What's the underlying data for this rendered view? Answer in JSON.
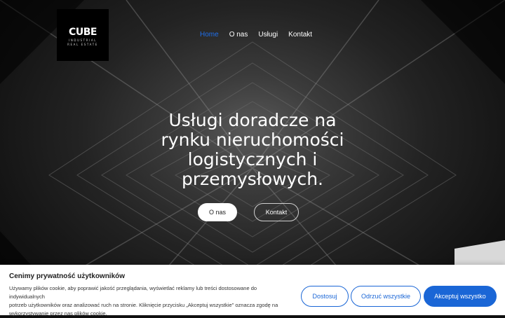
{
  "logo": {
    "mark": "CUBE",
    "line1": "INDUSTRIAL",
    "line2": "REAL ESTATE"
  },
  "nav": {
    "items": [
      {
        "label": "Home",
        "active": true
      },
      {
        "label": "O nas",
        "active": false
      },
      {
        "label": "Usługi",
        "active": false
      },
      {
        "label": "Kontakt",
        "active": false
      }
    ]
  },
  "hero": {
    "headline_lines": [
      "Usługi doradcze na",
      "rynku nieruchomości",
      "logistycznych i",
      "przemysłowych."
    ],
    "primary_button": "O nas",
    "secondary_button": "Kontakt"
  },
  "cookie_banner": {
    "title": "Cenimy prywatność użytkowników",
    "text_lines": [
      "Używamy plików cookie, aby poprawić jakość przeglądania, wyświetlać reklamy lub treści dostosowane do indywidualnych",
      "potrzeb użytkowników oraz analizować ruch na stronie. Kliknięcie przycisku „Akceptuj wszystkie\" oznacza zgodę na",
      "wykorzystywanie przez nas plików cookie."
    ],
    "customize_label": "Dostosuj",
    "reject_label": "Odrzuć wszystkie",
    "accept_label": "Akceptuj wszystko"
  },
  "colors": {
    "accent": "#1a66d6",
    "nav_active": "#1f6feb",
    "text_dark": "#1d1d1d"
  }
}
